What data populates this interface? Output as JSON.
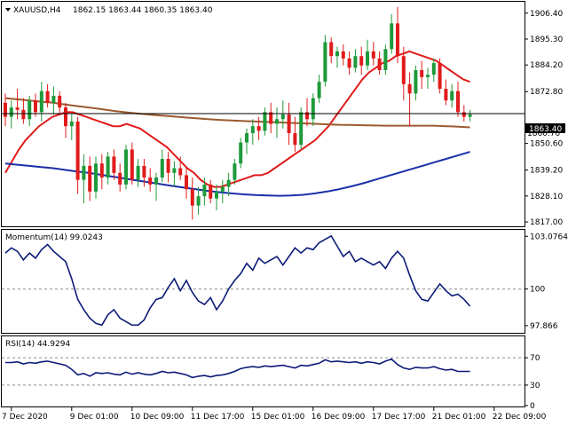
{
  "header": {
    "symbol": "XAUUSD,H4",
    "ohlc": "1862.15 1863.44 1860.35 1863.40"
  },
  "colors": {
    "up": "#1e9a3a",
    "down": "#e01b1b",
    "ma_fast": "#e01b1b",
    "ma_mid": "#9b5a2e",
    "ma_slow": "#1a2fa8",
    "indicator": "#0c1a78",
    "level": "#8a8a8a"
  },
  "main": {
    "price_label": "1863.40",
    "price_label_hidden": "1860.70",
    "ylim": [
      1815.5,
      1910.5
    ],
    "y_ticks": [
      "1906.40",
      "1895.30",
      "1884.20",
      "1872.80",
      "1850.60",
      "1839.20",
      "1828.10",
      "1817.00"
    ],
    "y_tick_values": [
      1906.4,
      1895.3,
      1884.2,
      1872.8,
      1850.6,
      1839.2,
      1828.1,
      1817.0
    ]
  },
  "momentum": {
    "label": "Momentum(14) 99.0243",
    "ylim": [
      97.5,
      103.4
    ],
    "y_ticks": [
      "103.0764",
      "100",
      "97.866"
    ],
    "y_tick_values": [
      103.0764,
      100,
      97.866
    ],
    "level": 100
  },
  "rsi": {
    "label": "RSI(14) 44.9294",
    "ylim": [
      0,
      100
    ],
    "y_ticks": [
      "70",
      "30",
      "0"
    ],
    "y_tick_values": [
      70,
      30,
      0
    ],
    "levels": [
      70,
      30
    ]
  },
  "x_axis": {
    "labels": [
      "7 Dec 2020",
      "9 Dec 01:00",
      "10 Dec 09:00",
      "11 Dec 17:00",
      "15 Dec 01:00",
      "16 Dec 09:00",
      "17 Dec 17:00",
      "21 Dec 01:00",
      "22 Dec 09:00"
    ],
    "label_bar_index": [
      1,
      11,
      21,
      31,
      41,
      51,
      61,
      71,
      81
    ]
  },
  "chart_data": {
    "type": "candlestick",
    "symbol": "XAUUSD",
    "timeframe": "H4",
    "candles": [
      [
        1868,
        1872,
        1858,
        1862
      ],
      [
        1862,
        1869,
        1857,
        1866
      ],
      [
        1866,
        1874,
        1861,
        1865
      ],
      [
        1865,
        1870,
        1859,
        1861
      ],
      [
        1861,
        1871,
        1858,
        1869
      ],
      [
        1869,
        1872,
        1862,
        1864
      ],
      [
        1864,
        1877,
        1860,
        1873
      ],
      [
        1873,
        1876,
        1866,
        1868
      ],
      [
        1868,
        1875,
        1863,
        1871
      ],
      [
        1871,
        1873,
        1863,
        1866
      ],
      [
        1866,
        1868,
        1853,
        1858
      ],
      [
        1858,
        1863,
        1852,
        1860
      ],
      [
        1860,
        1862,
        1829,
        1835
      ],
      [
        1835,
        1846,
        1825,
        1841
      ],
      [
        1841,
        1845,
        1826,
        1830
      ],
      [
        1830,
        1845,
        1827,
        1842
      ],
      [
        1842,
        1846,
        1831,
        1836
      ],
      [
        1836,
        1847,
        1833,
        1845
      ],
      [
        1845,
        1848,
        1835,
        1838
      ],
      [
        1838,
        1842,
        1830,
        1833
      ],
      [
        1833,
        1850,
        1831,
        1848
      ],
      [
        1848,
        1851,
        1833,
        1835
      ],
      [
        1835,
        1844,
        1832,
        1841
      ],
      [
        1841,
        1844,
        1832,
        1836
      ],
      [
        1836,
        1840,
        1830,
        1833
      ],
      [
        1833,
        1838,
        1826,
        1836
      ],
      [
        1836,
        1848,
        1834,
        1844
      ],
      [
        1844,
        1847,
        1834,
        1838
      ],
      [
        1838,
        1843,
        1832,
        1840
      ],
      [
        1840,
        1845,
        1835,
        1837
      ],
      [
        1837,
        1840,
        1827,
        1831
      ],
      [
        1831,
        1836,
        1818,
        1824
      ],
      [
        1824,
        1832,
        1820,
        1828
      ],
      [
        1828,
        1836,
        1824,
        1833
      ],
      [
        1833,
        1835,
        1825,
        1827
      ],
      [
        1827,
        1833,
        1822,
        1830
      ],
      [
        1830,
        1835,
        1825,
        1832
      ],
      [
        1832,
        1838,
        1828,
        1835
      ],
      [
        1835,
        1844,
        1833,
        1842
      ],
      [
        1842,
        1853,
        1840,
        1851
      ],
      [
        1851,
        1857,
        1846,
        1855
      ],
      [
        1855,
        1861,
        1850,
        1858
      ],
      [
        1858,
        1862,
        1852,
        1856
      ],
      [
        1856,
        1866,
        1854,
        1864
      ],
      [
        1864,
        1868,
        1855,
        1859
      ],
      [
        1859,
        1866,
        1853,
        1861
      ],
      [
        1861,
        1869,
        1857,
        1863
      ],
      [
        1863,
        1868,
        1850,
        1855
      ],
      [
        1855,
        1862,
        1847,
        1850
      ],
      [
        1850,
        1866,
        1848,
        1864
      ],
      [
        1864,
        1870,
        1858,
        1861
      ],
      [
        1861,
        1872,
        1858,
        1870
      ],
      [
        1870,
        1880,
        1868,
        1877
      ],
      [
        1877,
        1897,
        1875,
        1894
      ],
      [
        1894,
        1896,
        1885,
        1888
      ],
      [
        1888,
        1892,
        1883,
        1890
      ],
      [
        1890,
        1893,
        1884,
        1887
      ],
      [
        1887,
        1890,
        1880,
        1883
      ],
      [
        1883,
        1891,
        1881,
        1888
      ],
      [
        1888,
        1892,
        1880,
        1884
      ],
      [
        1884,
        1895,
        1882,
        1890
      ],
      [
        1890,
        1894,
        1884,
        1887
      ],
      [
        1887,
        1890,
        1880,
        1882
      ],
      [
        1882,
        1893,
        1880,
        1891
      ],
      [
        1891,
        1906,
        1889,
        1902
      ],
      [
        1902,
        1909,
        1885,
        1888
      ],
      [
        1888,
        1892,
        1869,
        1876
      ],
      [
        1876,
        1881,
        1858,
        1872
      ],
      [
        1872,
        1884,
        1869,
        1882
      ],
      [
        1882,
        1886,
        1874,
        1879
      ],
      [
        1879,
        1883,
        1874,
        1880
      ],
      [
        1880,
        1887,
        1877,
        1885
      ],
      [
        1885,
        1887,
        1872,
        1874
      ],
      [
        1874,
        1878,
        1867,
        1869
      ],
      [
        1869,
        1876,
        1866,
        1873
      ],
      [
        1873,
        1877,
        1862,
        1864
      ],
      [
        1864,
        1867,
        1860,
        1862
      ],
      [
        1862,
        1865,
        1860,
        1863
      ]
    ],
    "moving_averages": [
      {
        "color": "red",
        "values": [
          1838,
          1843,
          1848,
          1852,
          1855,
          1858,
          1860,
          1862,
          1863,
          1864,
          1864,
          1863,
          1862,
          1861,
          1860,
          1859,
          1858,
          1858,
          1859,
          1858,
          1857,
          1855,
          1853,
          1851,
          1849,
          1846,
          1843,
          1840,
          1838,
          1835,
          1833,
          1832,
          1832,
          1833,
          1834,
          1835,
          1836,
          1837,
          1837,
          1838,
          1840,
          1842,
          1844,
          1846,
          1848,
          1850,
          1852,
          1855,
          1858,
          1862,
          1866,
          1870,
          1874,
          1878,
          1881,
          1883,
          1885,
          1886,
          1888,
          1889,
          1890,
          1889,
          1888,
          1887,
          1886,
          1884,
          1882,
          1880,
          1878,
          1877
        ]
      },
      {
        "color": "brown",
        "values": [
          1870,
          1869.5,
          1869,
          1868.5,
          1868,
          1867.3,
          1866.6,
          1866,
          1865.3,
          1864.6,
          1864,
          1863.5,
          1863,
          1862.6,
          1862.2,
          1861.8,
          1861.4,
          1861,
          1860.7,
          1860.4,
          1860.2,
          1860,
          1859.8,
          1859.6,
          1859.4,
          1859.2,
          1859,
          1858.8,
          1858.6,
          1858.5,
          1858.4,
          1858.3,
          1858.2,
          1858.2,
          1858.2,
          1858.2,
          1858.2,
          1858,
          1857.8,
          1857.5
        ]
      },
      {
        "color": "blue",
        "values": [
          1842,
          1841.5,
          1841,
          1840.5,
          1840,
          1839.3,
          1838.6,
          1838,
          1837.2,
          1836.4,
          1835.6,
          1834.8,
          1834,
          1833.2,
          1832.4,
          1831.7,
          1831,
          1830.3,
          1829.7,
          1829.2,
          1828.8,
          1828.5,
          1828.3,
          1828.2,
          1828.3,
          1828.6,
          1829.2,
          1830,
          1831,
          1832.2,
          1833.5,
          1835,
          1836.5,
          1838,
          1839.5,
          1841,
          1842.5,
          1844,
          1845.5,
          1847
        ]
      }
    ],
    "momentum_values": [
      102.1,
      102.4,
      102.2,
      101.7,
      102.1,
      101.8,
      102.3,
      102.6,
      102.2,
      101.9,
      101.6,
      100.6,
      99.4,
      98.8,
      98.3,
      98.0,
      97.9,
      98.5,
      98.8,
      98.3,
      98.1,
      97.9,
      97.9,
      98.2,
      98.9,
      99.4,
      99.5,
      100.1,
      100.6,
      99.9,
      100.5,
      99.8,
      99.3,
      99.1,
      99.5,
      98.8,
      99.3,
      100.0,
      100.5,
      100.9,
      101.5,
      101.1,
      101.8,
      101.5,
      101.7,
      101.9,
      101.4,
      101.9,
      102.4,
      102.1,
      102.4,
      102.3,
      102.7,
      102.9,
      103.1,
      102.5,
      101.9,
      102.2,
      101.6,
      101.8,
      101.6,
      101.4,
      101.6,
      101.2,
      101.8,
      102.2,
      101.8,
      100.8,
      99.9,
      99.4,
      99.3,
      99.8,
      100.3,
      99.9,
      99.6,
      99.7,
      99.4,
      99.0
    ],
    "rsi_values": [
      63,
      63,
      64,
      61,
      63,
      62,
      64,
      65,
      63,
      61,
      59,
      53,
      45,
      47,
      43,
      48,
      47,
      48,
      46,
      45,
      49,
      46,
      48,
      46,
      45,
      47,
      50,
      48,
      49,
      47,
      45,
      41,
      43,
      44,
      42,
      44,
      45,
      47,
      50,
      54,
      56,
      57,
      56,
      58,
      57,
      58,
      59,
      57,
      55,
      59,
      58,
      60,
      62,
      67,
      64,
      65,
      64,
      63,
      64,
      62,
      64,
      63,
      61,
      65,
      68,
      60,
      55,
      53,
      56,
      55,
      55,
      57,
      54,
      52,
      53,
      50,
      50,
      50
    ],
    "current_price": 1863.4
  }
}
